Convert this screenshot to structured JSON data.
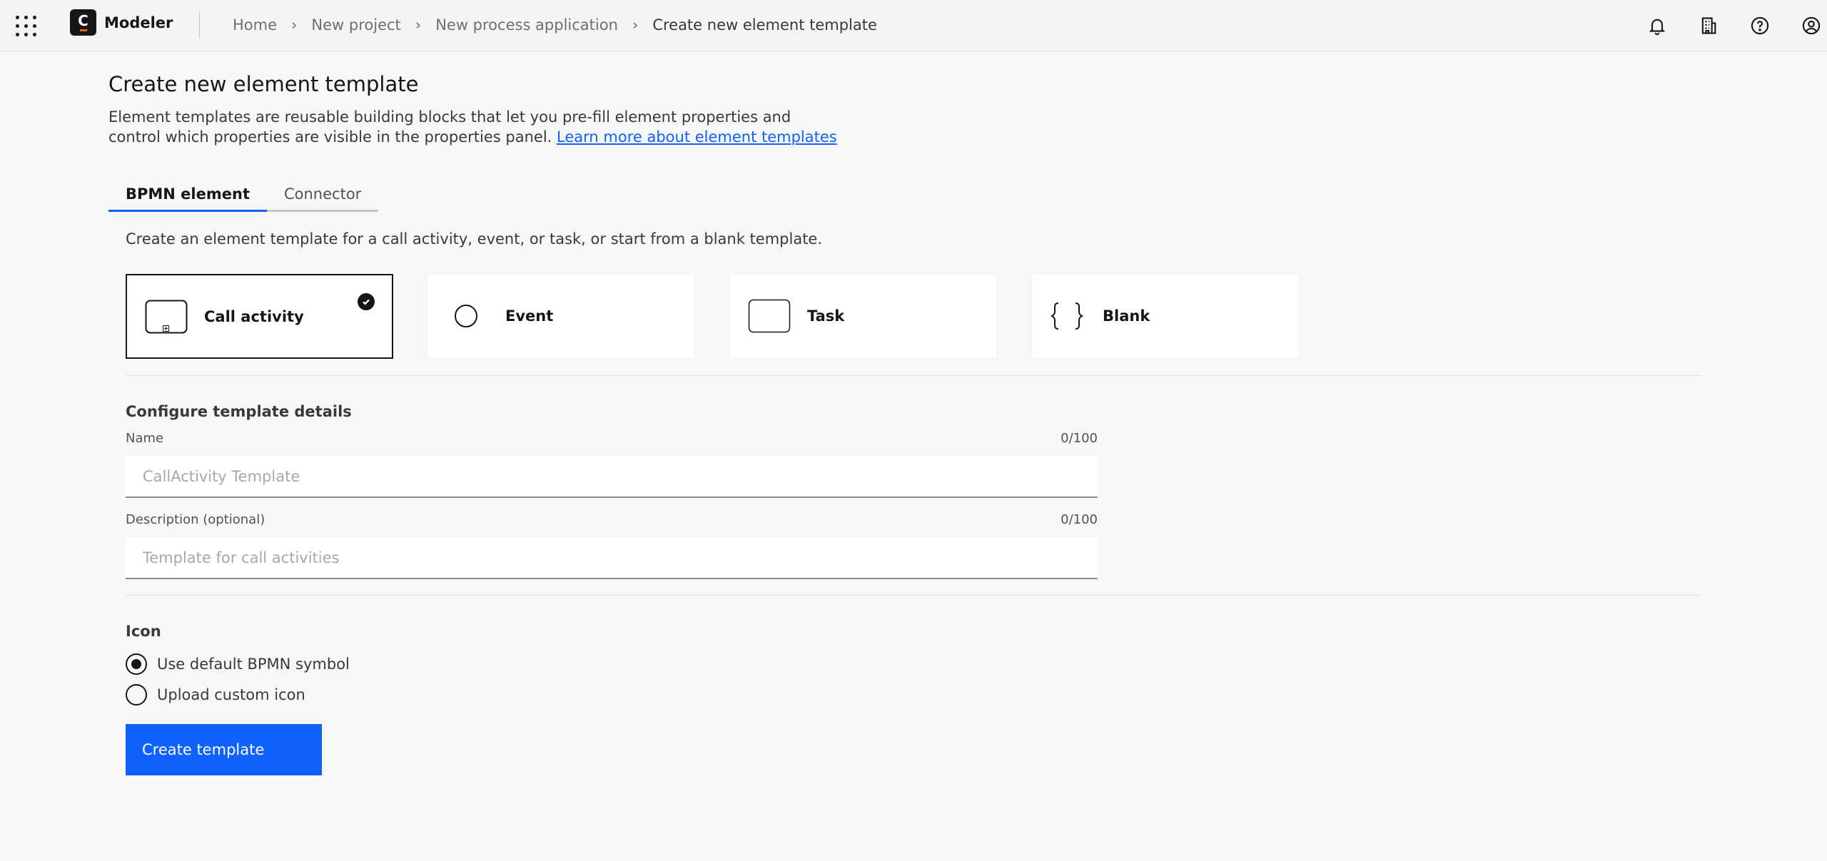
{
  "header": {
    "app_name": "Modeler",
    "logo_letter": "C",
    "breadcrumb": [
      {
        "label": "Home"
      },
      {
        "label": "New project"
      },
      {
        "label": "New process application"
      }
    ],
    "current_page": "Create new element template",
    "separator": "›",
    "icons": [
      "bell-icon",
      "building-icon",
      "help-icon",
      "user-avatar-icon"
    ]
  },
  "page": {
    "title": "Create new element template",
    "intro_text": "Element templates are reusable building blocks that let you pre-fill element properties and control which properties are visible in the properties panel.",
    "learn_more_link": "Learn more about element templates"
  },
  "tabs": [
    {
      "label": "BPMN element",
      "active": true
    },
    {
      "label": "Connector",
      "active": false
    }
  ],
  "bpmn_tab": {
    "description": "Create an element template for a call activity, event, or task, or start from a blank template.",
    "tiles": [
      {
        "label": "Call activity",
        "icon": "call-activity-icon",
        "selected": true
      },
      {
        "label": "Event",
        "icon": "event-circle-icon",
        "selected": false
      },
      {
        "label": "Task",
        "icon": "task-rect-icon",
        "selected": false
      },
      {
        "label": "Blank",
        "icon": "curly-braces-icon",
        "selected": false
      }
    ]
  },
  "details": {
    "section_title": "Configure template details",
    "name_label": "Name",
    "name_count": "0/100",
    "name_placeholder": "CallActivity Template",
    "name_value": "",
    "description_label": "Description (optional)",
    "description_count": "0/100",
    "description_placeholder": "Template for call activities",
    "description_value": ""
  },
  "icon_section": {
    "title": "Icon",
    "options": [
      {
        "label": "Use default BPMN symbol",
        "checked": true
      },
      {
        "label": "Upload custom icon",
        "checked": false
      }
    ]
  },
  "actions": {
    "create_label": "Create template"
  },
  "colors": {
    "primary": "#0f62fe",
    "background": "#f7f7f7",
    "text": "#161616",
    "brand_accent": "#fc5d0d"
  }
}
